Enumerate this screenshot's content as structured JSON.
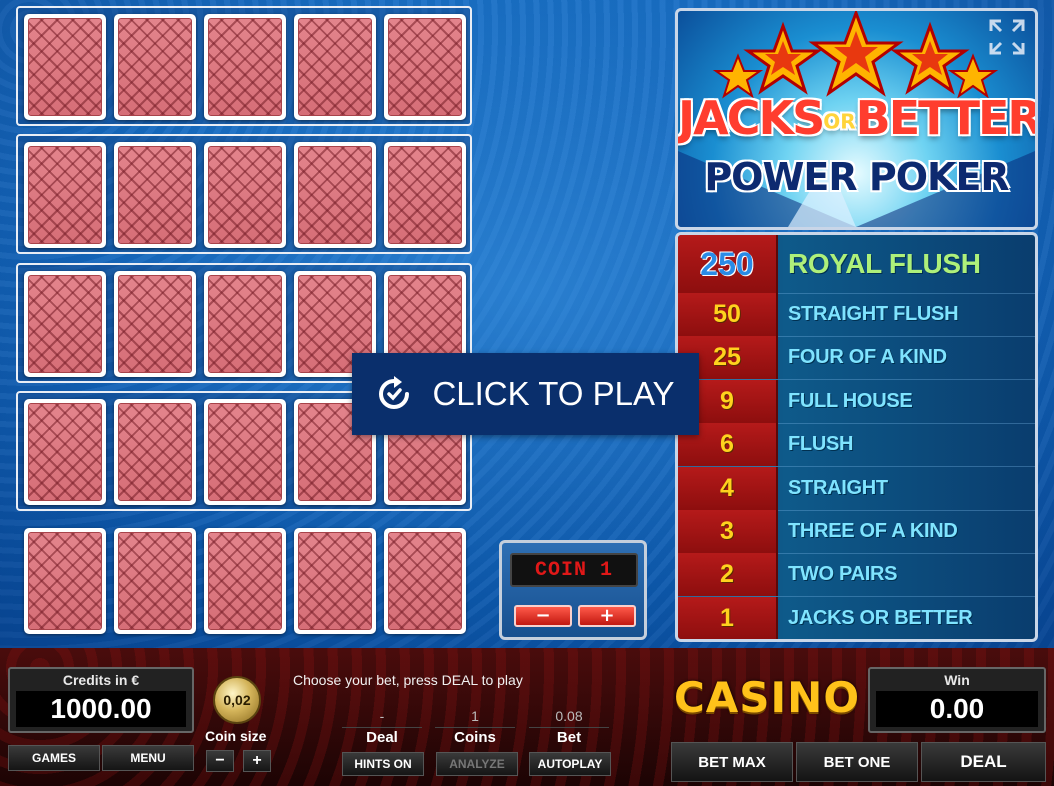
{
  "game": {
    "logo_line1_a": "JACKS",
    "logo_line1_or": "OR",
    "logo_line1_b": "BETTER",
    "logo_line2": "POWER POKER"
  },
  "paytable": [
    {
      "value": "250",
      "hand": "ROYAL FLUSH"
    },
    {
      "value": "50",
      "hand": "STRAIGHT FLUSH"
    },
    {
      "value": "25",
      "hand": "FOUR OF A KIND"
    },
    {
      "value": "9",
      "hand": "FULL HOUSE"
    },
    {
      "value": "6",
      "hand": "FLUSH"
    },
    {
      "value": "4",
      "hand": "STRAIGHT"
    },
    {
      "value": "3",
      "hand": "THREE OF A KIND"
    },
    {
      "value": "2",
      "hand": "TWO PAIRS"
    },
    {
      "value": "1",
      "hand": "JACKS OR BETTER"
    }
  ],
  "overlay": {
    "click_to_play": "CLICK TO PLAY"
  },
  "coin_box": {
    "display": "COIN 1",
    "minus": "−",
    "plus": "+"
  },
  "credits": {
    "label": "Credits in €",
    "value": "1000.00"
  },
  "win": {
    "label": "Win",
    "value": "0.00"
  },
  "coin_size": {
    "label": "Coin size",
    "value": "0,02",
    "minus": "−",
    "plus": "+"
  },
  "instructions": "Choose your bet, press DEAL to play",
  "stats": {
    "deal_value": "-",
    "deal_label": "Deal",
    "coins_value": "1",
    "coins_label": "Coins",
    "bet_value": "0.08",
    "bet_label": "Bet"
  },
  "buttons": {
    "games": "GAMES",
    "menu": "MENU",
    "hints_on": "HINTS ON",
    "analyze": "ANALYZE",
    "autoplay": "AUTOPLAY",
    "bet_max": "BET MAX",
    "bet_one": "BET ONE",
    "deal": "DEAL"
  },
  "brand": "CASINO",
  "hands_count": 5,
  "cards_per_hand": 5,
  "colors": {
    "card_back": "#d66e77",
    "paytable_value_bg": "#b51a1a",
    "paytable_text": "#7fe4ff",
    "overlay_bg": "#0a2f6c"
  }
}
